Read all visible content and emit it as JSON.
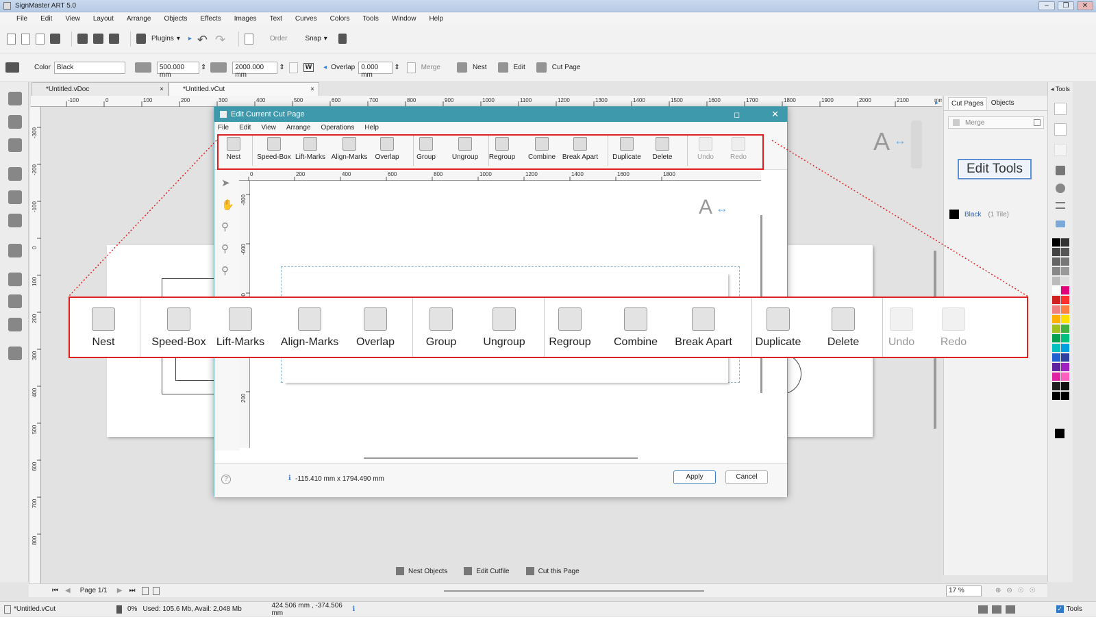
{
  "window": {
    "title": "SignMaster ART 5.0"
  },
  "menubar": [
    "File",
    "Edit",
    "View",
    "Layout",
    "Arrange",
    "Objects",
    "Effects",
    "Images",
    "Text",
    "Curves",
    "Colors",
    "Tools",
    "Window",
    "Help"
  ],
  "toolbar1": {
    "plugins": "Plugins",
    "order": "Order",
    "snap": "Snap"
  },
  "toolbar2": {
    "color_label": "Color",
    "color_value": "Black",
    "width_value": "500.000 mm",
    "height_value": "2000.000 mm",
    "w_label": "W",
    "overlap_label": "Overlap",
    "overlap_value": "0.000 mm",
    "merge": "Merge",
    "nest": "Nest",
    "edit": "Edit",
    "cut_page": "Cut Page"
  },
  "tabs": [
    "*Untitled.vDoc",
    "*Untitled.vCut"
  ],
  "ruler_top": [
    "-100",
    "0",
    "100",
    "200",
    "300",
    "400",
    "500",
    "600",
    "700",
    "800",
    "900",
    "1000",
    "1100",
    "1200",
    "1300",
    "1400",
    "1500",
    "1600",
    "1700",
    "1800",
    "1900",
    "2000",
    "2100",
    "mm"
  ],
  "ruler_left": [
    "-300",
    "-200",
    "-100",
    "0",
    "100",
    "200",
    "300",
    "400",
    "500",
    "600",
    "700",
    "800"
  ],
  "right_panel": {
    "tabs": [
      "Cut Pages",
      "Objects"
    ],
    "merge": "Merge",
    "edit_tools": "Edit Tools",
    "color_name": "Black",
    "tile_count": "(1 Tile)",
    "tools_header": "Tools"
  },
  "dialog": {
    "title": "Edit Current Cut Page",
    "menu": [
      "File",
      "Edit",
      "View",
      "Arrange",
      "Operations",
      "Help"
    ],
    "tools": [
      {
        "label": "Nest",
        "icon": "nest-icon",
        "enabled": true
      },
      {
        "label": "Speed-Box",
        "icon": "speed-box-icon",
        "enabled": true
      },
      {
        "label": "Lift-Marks",
        "icon": "lift-marks-icon",
        "enabled": true
      },
      {
        "label": "Align-Marks",
        "icon": "align-marks-icon",
        "enabled": true
      },
      {
        "label": "Overlap",
        "icon": "overlap-icon",
        "enabled": true
      },
      {
        "label": "Group",
        "icon": "group-icon",
        "enabled": true
      },
      {
        "label": "Ungroup",
        "icon": "ungroup-icon",
        "enabled": true
      },
      {
        "label": "Regroup",
        "icon": "regroup-icon",
        "enabled": true
      },
      {
        "label": "Combine",
        "icon": "combine-icon",
        "enabled": true
      },
      {
        "label": "Break Apart",
        "icon": "break-apart-icon",
        "enabled": true
      },
      {
        "label": "Duplicate",
        "icon": "duplicate-icon",
        "enabled": true
      },
      {
        "label": "Delete",
        "icon": "delete-icon",
        "enabled": true
      },
      {
        "label": "Undo",
        "icon": "undo-icon",
        "enabled": false
      },
      {
        "label": "Redo",
        "icon": "redo-icon",
        "enabled": false
      }
    ],
    "ruler_top": [
      "0",
      "200",
      "400",
      "600",
      "800",
      "1000",
      "1200",
      "1400",
      "1600",
      "1800"
    ],
    "ruler_left": [
      "-800",
      "-600",
      "-400",
      "0",
      "200"
    ],
    "coords": "-115.410 mm x 1794.490 mm",
    "apply": "Apply",
    "cancel": "Cancel"
  },
  "bottom_actions": [
    "Nest Objects",
    "Edit Cutfile",
    "Cut this Page"
  ],
  "page_nav": {
    "page": "Page 1/1"
  },
  "zoom": "17 %",
  "status": {
    "file": "*Untitled.vCut",
    "percent": "0%",
    "memory": "Used: 105.6 Mb, Avail: 2,048 Mb",
    "position": "424.506 mm , -374.506 mm",
    "tools": "Tools"
  },
  "colors": {
    "accent_red": "#e02020",
    "dialog_title": "#3f99ad",
    "link_blue": "#2c5fb5"
  }
}
